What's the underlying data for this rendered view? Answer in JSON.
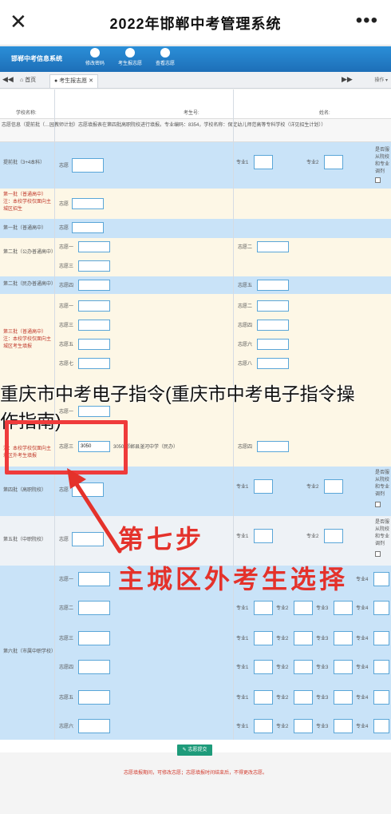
{
  "window": {
    "title": "2022年邯郸中考管理系统",
    "close_icon": "close-icon",
    "more_icon": "more-icon"
  },
  "sysbar": {
    "brand": "邯郸中考信息系统",
    "nav": [
      {
        "label": "修改密码"
      },
      {
        "label": "考生报志愿"
      },
      {
        "label": "查看志愿"
      }
    ]
  },
  "tabbar": {
    "home": "首页",
    "active_tab": "考生报志愿",
    "ops": "操作 ▾"
  },
  "form": {
    "school_label": "学校名称:",
    "examno_label": "考生号:",
    "name_label": "姓名:",
    "info_text": "志愿信息（提前批（…园教师计划）志愿填报表在第四批高职院校进行填报。专业编码：8354，学校名称：保定幼儿师范高等专科学校（详见招生计划））",
    "rows": {
      "tiqian": "提前批（3+4本科）",
      "diyi_a": "第一批（普通高中）注：本校学校仅面向主城区招生",
      "diyi_b": "第一批（普通高中）",
      "dier_a": "第二批（公办普通高中）",
      "dier_b": "第二批（民办普通高中）",
      "disan": "第三批（普通高中）注：本校学校仅面向主城区考生填报",
      "disan_c": "注：本校学校仅面向主城区外考生填报",
      "disi": "第四批（高职院校）",
      "diwu": "第五批（中职院校）",
      "diliu": "第六批（市属中职学校）"
    },
    "zhiyuan": "志愿",
    "zy1": "志愿一",
    "zy2": "志愿二",
    "zy3": "志愿三",
    "zy4": "志愿四",
    "zy5": "志愿五",
    "zy6": "志愿六",
    "zy7": "志愿七",
    "zy8": "志愿八",
    "zhuanye1": "专业1",
    "zhuanye2": "专业2",
    "zhuanye3": "专业3",
    "zhuanye4": "专业4",
    "tiaoji": "是否服从院校和专业调剂",
    "tiaoji_opt": "是",
    "selected_code": "3050",
    "selected_school": "3050 邯郸县滏河中学（民办）",
    "submit": "志愿提交",
    "note": "志愿填报期间，可修改志愿；志愿填报时间结束后，不得更改志愿。"
  },
  "overlay": {
    "watermark_line1": "重庆市中考电子指令(重庆市中考电子指令操",
    "watermark_line2": "作指南)",
    "step_title": "第七步",
    "step_desc": "主城区外考生选择",
    "accent": "#e4322b"
  }
}
